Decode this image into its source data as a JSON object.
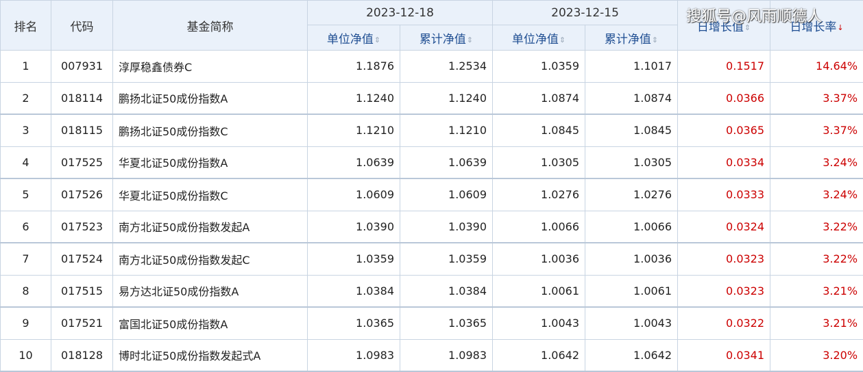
{
  "headers": {
    "rank": "排名",
    "code": "代码",
    "name": "基金简称",
    "date1": "2023-12-18",
    "date2": "2023-12-15",
    "unit_nav": "单位净值",
    "acc_nav": "累计净值",
    "daily_change": "日增长值",
    "daily_rate": "日增长率"
  },
  "watermark": "搜狐号@风雨顺德人",
  "colors": {
    "header_bg": "#eaf1fa",
    "link_blue": "#1f4e92",
    "positive_red": "#cc0000",
    "border": "#c8d4e2"
  },
  "rows": [
    {
      "rank": "1",
      "code": "007931",
      "name": "淳厚稳鑫债券C",
      "unit1": "1.1876",
      "acc1": "1.2534",
      "unit2": "1.0359",
      "acc2": "1.1017",
      "change": "0.1517",
      "rate": "14.64%"
    },
    {
      "rank": "2",
      "code": "018114",
      "name": "鹏扬北证50成份指数A",
      "unit1": "1.1240",
      "acc1": "1.1240",
      "unit2": "1.0874",
      "acc2": "1.0874",
      "change": "0.0366",
      "rate": "3.37%"
    },
    {
      "rank": "3",
      "code": "018115",
      "name": "鹏扬北证50成份指数C",
      "unit1": "1.1210",
      "acc1": "1.1210",
      "unit2": "1.0845",
      "acc2": "1.0845",
      "change": "0.0365",
      "rate": "3.37%"
    },
    {
      "rank": "4",
      "code": "017525",
      "name": "华夏北证50成份指数A",
      "unit1": "1.0639",
      "acc1": "1.0639",
      "unit2": "1.0305",
      "acc2": "1.0305",
      "change": "0.0334",
      "rate": "3.24%"
    },
    {
      "rank": "5",
      "code": "017526",
      "name": "华夏北证50成份指数C",
      "unit1": "1.0609",
      "acc1": "1.0609",
      "unit2": "1.0276",
      "acc2": "1.0276",
      "change": "0.0333",
      "rate": "3.24%"
    },
    {
      "rank": "6",
      "code": "017523",
      "name": "南方北证50成份指数发起A",
      "unit1": "1.0390",
      "acc1": "1.0390",
      "unit2": "1.0066",
      "acc2": "1.0066",
      "change": "0.0324",
      "rate": "3.22%"
    },
    {
      "rank": "7",
      "code": "017524",
      "name": "南方北证50成份指数发起C",
      "unit1": "1.0359",
      "acc1": "1.0359",
      "unit2": "1.0036",
      "acc2": "1.0036",
      "change": "0.0323",
      "rate": "3.22%"
    },
    {
      "rank": "8",
      "code": "017515",
      "name": "易方达北证50成份指数A",
      "unit1": "1.0384",
      "acc1": "1.0384",
      "unit2": "1.0061",
      "acc2": "1.0061",
      "change": "0.0323",
      "rate": "3.21%"
    },
    {
      "rank": "9",
      "code": "017521",
      "name": "富国北证50成份指数A",
      "unit1": "1.0365",
      "acc1": "1.0365",
      "unit2": "1.0043",
      "acc2": "1.0043",
      "change": "0.0322",
      "rate": "3.21%"
    },
    {
      "rank": "10",
      "code": "018128",
      "name": "博时北证50成份指数发起式A",
      "unit1": "1.0983",
      "acc1": "1.0983",
      "unit2": "1.0642",
      "acc2": "1.0642",
      "change": "0.0341",
      "rate": "3.20%"
    }
  ]
}
